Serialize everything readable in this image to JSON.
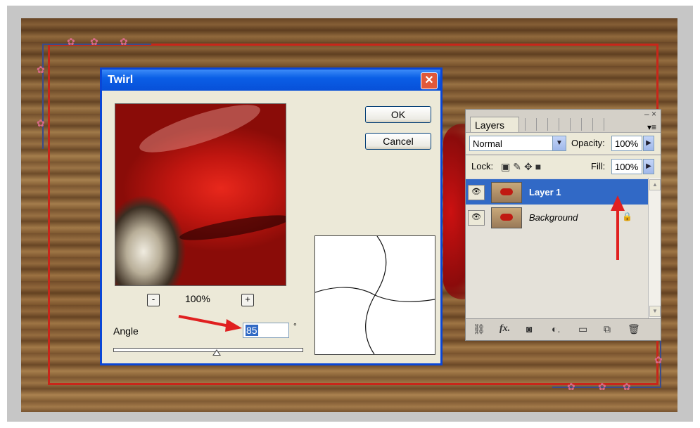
{
  "twirl_dialog": {
    "title": "Twirl",
    "close_glyph": "✕",
    "ok_label": "OK",
    "cancel_label": "Cancel",
    "zoom_out_glyph": "-",
    "zoom_in_glyph": "+",
    "zoom_level": "100%",
    "angle_label": "Angle",
    "angle_value": "85",
    "degree_symbol": "°",
    "angle_slider_fraction": 0.55
  },
  "layers_panel": {
    "tab_label": "Layers",
    "tab_close": "×",
    "window_controls": "– ×",
    "panel_menu_glyph": "▾≡",
    "blend_mode": "Normal",
    "opacity_label": "Opacity:",
    "opacity_value": "100%",
    "lock_label": "Lock:",
    "fill_label": "Fill:",
    "fill_value": "100%",
    "layers": [
      {
        "name": "Layer 1",
        "selected": true,
        "locked": false
      },
      {
        "name": "Background",
        "selected": false,
        "locked": true
      }
    ],
    "bottom_icons": [
      "link-icon",
      "fx-icon",
      "mask-icon",
      "adjustment-icon",
      "folder-icon",
      "new-layer-icon",
      "trash-icon"
    ]
  },
  "colors": {
    "dialog_title": "#0a5ee6",
    "selection": "#3169c6",
    "annotation_arrow": "#e02020",
    "frame_border": "#c8261a"
  }
}
